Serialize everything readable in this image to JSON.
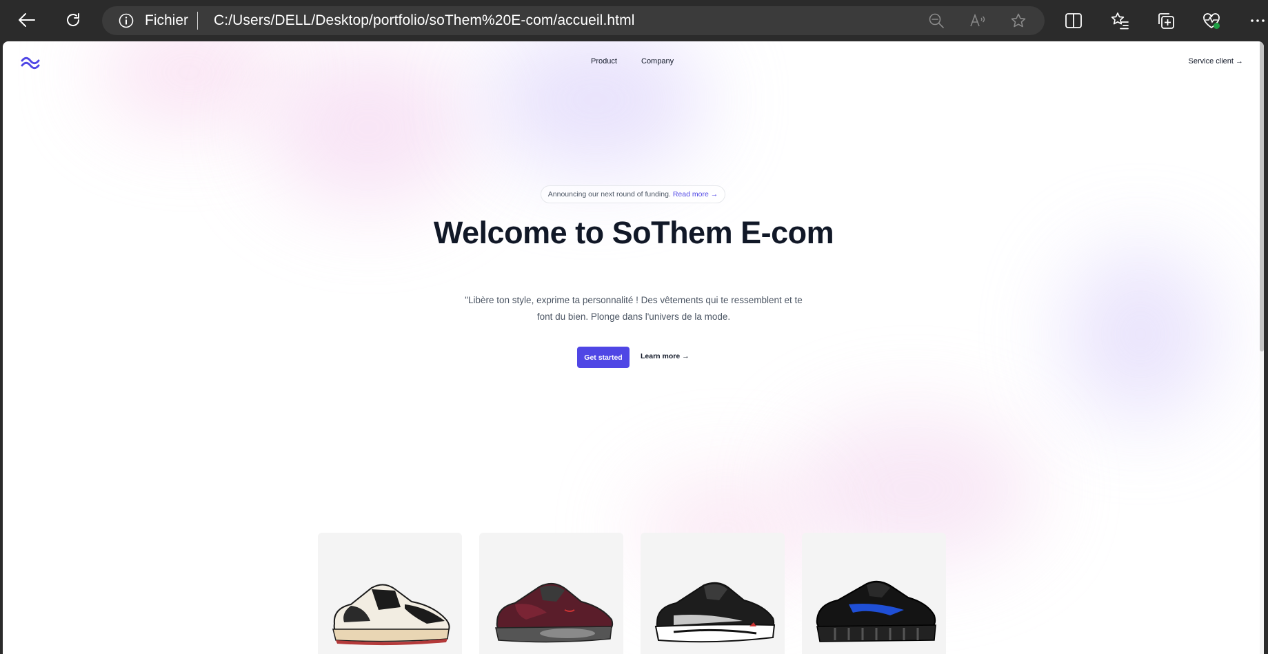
{
  "browser": {
    "protocol_label": "Fichier",
    "url": "C:/Users/DELL/Desktop/portfolio/soThem%20E-com/accueil.html"
  },
  "nav": {
    "links": [
      "Product",
      "Company"
    ],
    "service_link": "Service client →"
  },
  "announcement": {
    "text": "Announcing our next round of funding.",
    "link": "Read more →"
  },
  "hero": {
    "title": "Welcome to SoThem E-com",
    "subtitle": "\"Libère ton style, exprime ta personnalité ! Des vêtements qui te ressemblent et te font du bien. Plonge dans l'univers de la mode.",
    "primary_button": "Get started",
    "secondary_link": "Learn more →"
  },
  "products": [
    {
      "image": "sneaker-cream-black-icon"
    },
    {
      "image": "sneaker-red-grey-icon"
    },
    {
      "image": "sneaker-black-white-icon"
    },
    {
      "image": "sneaker-black-blue-icon"
    }
  ],
  "colors": {
    "accent": "#4f46e5",
    "heading": "#111827",
    "chrome_bg": "#2b2b2b",
    "card_bg": "#f4f4f4"
  }
}
